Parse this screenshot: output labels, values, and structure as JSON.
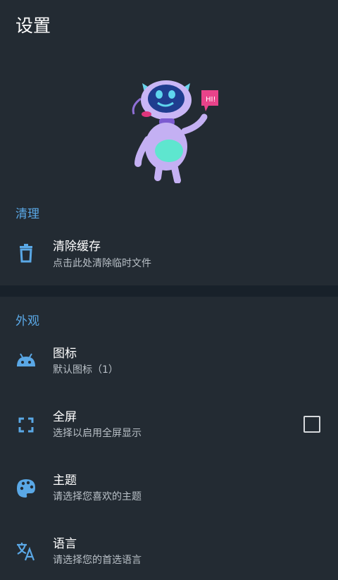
{
  "title": "设置",
  "sections": [
    {
      "header": "清理",
      "items": [
        {
          "label": "清除缓存",
          "sub": "点击此处清除临时文件",
          "icon": "trash-icon"
        }
      ]
    },
    {
      "header": "外观",
      "items": [
        {
          "label": "图标",
          "sub": "默认图标（1）",
          "icon": "android-icon"
        },
        {
          "label": "全屏",
          "sub": "选择以启用全屏显示",
          "icon": "fullscreen-icon",
          "checked": false
        },
        {
          "label": "主题",
          "sub": "请选择您喜欢的主题",
          "icon": "palette-icon"
        },
        {
          "label": "语言",
          "sub": "请选择您的首选语言",
          "icon": "translate-icon"
        }
      ]
    }
  ],
  "mascot_bubble_text": "HI!",
  "colors": {
    "background": "#232b33",
    "accent": "#5aa8e6",
    "divider": "#18212a"
  }
}
